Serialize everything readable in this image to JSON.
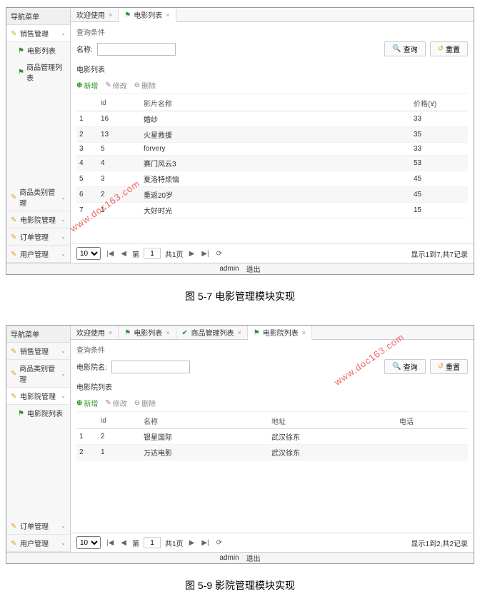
{
  "caption1": "图 5-7 电影管理模块实现",
  "caption2": "图 5-9 影院管理模块实现",
  "watermark": "www.doc163.com",
  "s1": {
    "sidebar": {
      "title": "导航菜单",
      "cat1": "销售管理",
      "item1": "电影列表",
      "item2": "商品管理列表",
      "bottom": [
        "商品类别管理",
        "电影院管理",
        "订单管理",
        "用户管理"
      ]
    },
    "tabs": [
      "欢迎使用",
      "电影列表"
    ],
    "panelTitle": "查询条件",
    "searchLabel": "名称:",
    "btnSearch": "查询",
    "btnReset": "重置",
    "listTitle": "电影列表",
    "tbAdd": "新增",
    "tbEdit": "修改",
    "tbDel": "删除",
    "th": [
      "",
      "id",
      "影片名称",
      "价格(¥)"
    ],
    "rows": [
      {
        "n": "1",
        "id": "16",
        "name": "婚纱",
        "price": "33"
      },
      {
        "n": "2",
        "id": "13",
        "name": "火星救援",
        "price": "35"
      },
      {
        "n": "3",
        "id": "5",
        "name": "forvery",
        "price": "33"
      },
      {
        "n": "4",
        "id": "4",
        "name": "赛门风云3",
        "price": "53"
      },
      {
        "n": "5",
        "id": "3",
        "name": "夏洛特烦恼",
        "price": "45"
      },
      {
        "n": "6",
        "id": "2",
        "name": "重返20岁",
        "price": "45"
      },
      {
        "n": "7",
        "id": "1",
        "name": "大好时光",
        "price": "15"
      }
    ],
    "pager": {
      "size": "10",
      "pageLabel1": "第",
      "page": "1",
      "pageLabel2": "共1页",
      "info": "显示1到7,共7记录"
    },
    "footer": {
      "user": "admin",
      "logout": "退出"
    }
  },
  "s2": {
    "sidebar": {
      "title": "导航菜单",
      "items": [
        "销售管理",
        "商品类别管理",
        "电影院管理"
      ],
      "active": "电影院列表",
      "bottom": [
        "订单管理",
        "用户管理"
      ]
    },
    "tabs": [
      "欢迎使用",
      "电影列表",
      "商品管理列表",
      "电影院列表"
    ],
    "panelTitle": "查询条件",
    "searchLabel": "电影院名:",
    "btnSearch": "查询",
    "btnReset": "重置",
    "listTitle": "电影院列表",
    "tbAdd": "新增",
    "tbEdit": "修改",
    "tbDel": "删除",
    "th": [
      "",
      "id",
      "名称",
      "地址",
      "电话"
    ],
    "rows": [
      {
        "n": "1",
        "id": "2",
        "name": "银星国际",
        "addr": "武汉徐东",
        "tel": ""
      },
      {
        "n": "2",
        "id": "1",
        "name": "万达电影",
        "addr": "武汉徐东",
        "tel": ""
      }
    ],
    "pager": {
      "size": "10",
      "pageLabel1": "第",
      "page": "1",
      "pageLabel2": "共1页",
      "info": "显示1到2,共2记录"
    },
    "footer": {
      "user": "admin",
      "logout": "退出"
    }
  }
}
